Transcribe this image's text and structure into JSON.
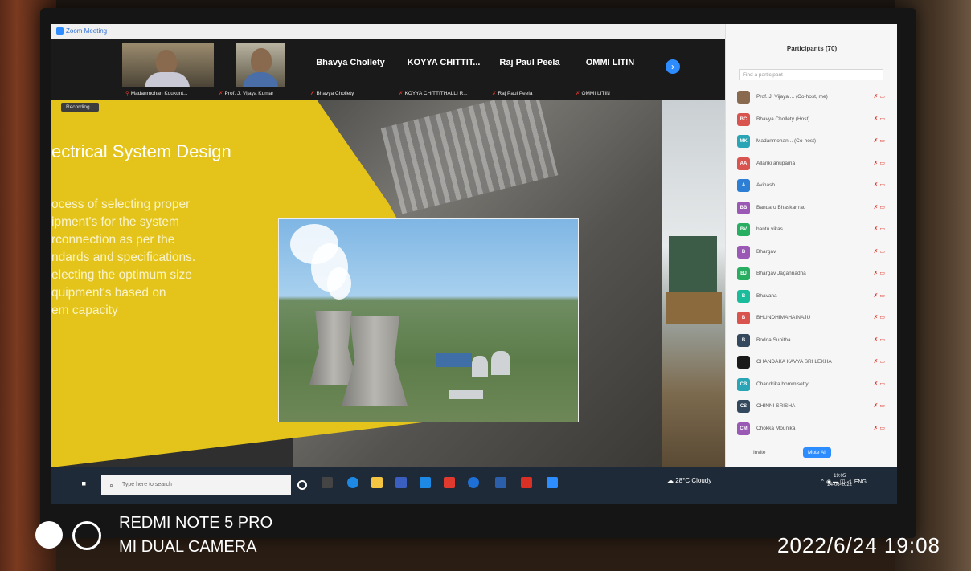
{
  "window": {
    "title": "Zoom Meeting"
  },
  "gallery": {
    "tiles": [
      {
        "name": "Madanmohan Koukunt..."
      },
      {
        "name": "Prof. J. Vijaya Kumar"
      },
      {
        "big": "Bhavya Chollety",
        "name": "Bhavya Chollety"
      },
      {
        "big": "KOYYA CHITTIT...",
        "name": "KOYYA CHITTITHALLI R..."
      },
      {
        "big": "Raj Paul Peela",
        "name": "Raj Paul Peela"
      },
      {
        "big": "OMMI LITIN",
        "name": "OMMI LITIN"
      }
    ]
  },
  "slide": {
    "recording_label": "Recording...",
    "title": "ectrical System Design",
    "body": "ocess of selecting proper\nipment's for the system\nrconnection as per the\nndards and specifications.\nelecting the optimum size\nquipment's based on\nem capacity"
  },
  "participants": {
    "title": "Participants (70)",
    "search_placeholder": "Find a participant",
    "list": [
      {
        "initials": "",
        "name": "Prof. J. Vijaya ... (Co-host, me)",
        "color": "#8a6a4e"
      },
      {
        "initials": "BC",
        "name": "Bhavya Chollety (Host)",
        "color": "#d9534f"
      },
      {
        "initials": "MK",
        "name": "Madanmohan... (Co-host)",
        "color": "#2aa5b5"
      },
      {
        "initials": "AA",
        "name": "Allanki anupama",
        "color": "#d9534f"
      },
      {
        "initials": "A",
        "name": "Avinash",
        "color": "#2d7fd6"
      },
      {
        "initials": "BB",
        "name": "Bandaru Bhaskar rao",
        "color": "#9b59b6"
      },
      {
        "initials": "BV",
        "name": "bantu vikas",
        "color": "#27ae60"
      },
      {
        "initials": "B",
        "name": "Bhargav",
        "color": "#9b59b6"
      },
      {
        "initials": "BJ",
        "name": "Bhargav Jagannadha",
        "color": "#27ae60"
      },
      {
        "initials": "B",
        "name": "Bhavana",
        "color": "#1abc9c"
      },
      {
        "initials": "B",
        "name": "BHUNDHIMAHAINAJU",
        "color": "#d9534f"
      },
      {
        "initials": "B",
        "name": "Bodda Sunitha",
        "color": "#34495e"
      },
      {
        "initials": "",
        "name": "CHANDAKA KAVYA SRI LEKHA",
        "color": "#1a1a1a"
      },
      {
        "initials": "CB",
        "name": "Chandrika bommisetty",
        "color": "#2aa5b5"
      },
      {
        "initials": "CS",
        "name": "CHINNI SRISHA",
        "color": "#34495e"
      },
      {
        "initials": "CM",
        "name": "Chokka Mounika",
        "color": "#9b59b6"
      }
    ],
    "invite_label": "Invite",
    "mute_all_label": "Mute All"
  },
  "taskbar": {
    "search_placeholder": "Type here to search",
    "weather": "28°C Cloudy",
    "lang": "ENG",
    "time": "19:05",
    "date": "24-06-2022"
  },
  "photo_overlay": {
    "camera_line1": "REDMI NOTE 5 PRO",
    "camera_line2": "MI DUAL CAMERA",
    "timestamp": "2022/6/24  19:08"
  }
}
